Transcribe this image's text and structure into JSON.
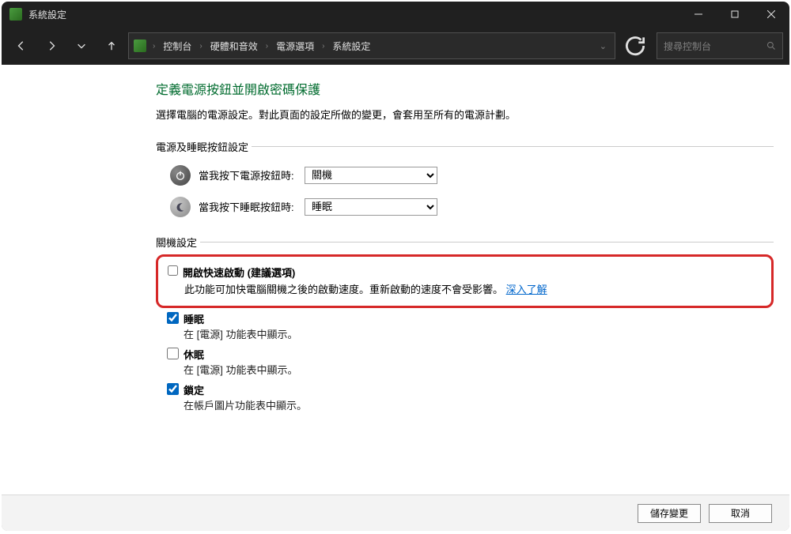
{
  "titlebar": {
    "title": "系統設定"
  },
  "breadcrumb": {
    "items": [
      "控制台",
      "硬體和音效",
      "電源選項",
      "系統設定"
    ]
  },
  "search": {
    "placeholder": "搜尋控制台"
  },
  "page": {
    "title": "定義電源按鈕並開啟密碼保護",
    "description": "選擇電腦的電源設定。對此頁面的設定所做的變更，會套用至所有的電源計劃。"
  },
  "section_power": {
    "legend": "電源及睡眠按鈕設定",
    "rows": [
      {
        "label": "當我按下電源按鈕時:",
        "value": "關機"
      },
      {
        "label": "當我按下睡眠按鈕時:",
        "value": "睡眠"
      }
    ]
  },
  "section_shutdown": {
    "legend": "關機設定",
    "fast_startup": {
      "checked": false,
      "label": "開啟快速啟動 (建議選項)",
      "sub_pre": "此功能可加快電腦關機之後的啟動速度。重新啟動的速度不會受影響。",
      "link": "深入了解"
    },
    "sleep": {
      "checked": true,
      "label": "睡眠",
      "sub": "在 [電源] 功能表中顯示。"
    },
    "hibernate": {
      "checked": false,
      "label": "休眠",
      "sub": "在 [電源] 功能表中顯示。"
    },
    "lock": {
      "checked": true,
      "label": "鎖定",
      "sub": "在帳戶圖片功能表中顯示。"
    }
  },
  "buttons": {
    "save": "儲存變更",
    "cancel": "取消"
  }
}
